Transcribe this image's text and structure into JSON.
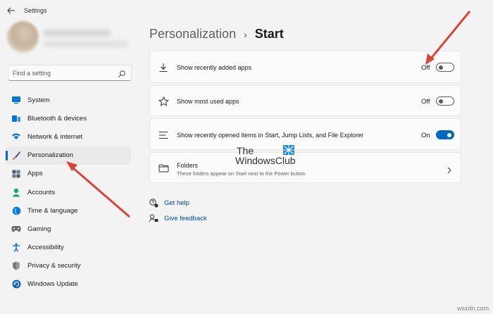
{
  "titlebar": {
    "title": "Settings",
    "back_icon": "back-arrow-icon"
  },
  "search": {
    "placeholder": "Find a setting",
    "icon": "search-icon"
  },
  "sidebar": {
    "items": [
      {
        "label": "System",
        "icon": "system-icon",
        "color": "#0078d4"
      },
      {
        "label": "Bluetooth & devices",
        "icon": "bluetooth-icon",
        "color": "#0078d4"
      },
      {
        "label": "Network & internet",
        "icon": "wifi-icon",
        "color": "#0b78c8"
      },
      {
        "label": "Personalization",
        "icon": "brush-icon",
        "color": "#c86a3c",
        "active": true
      },
      {
        "label": "Apps",
        "icon": "apps-icon",
        "color": "#4a5a6a"
      },
      {
        "label": "Accounts",
        "icon": "accounts-icon",
        "color": "#1aa36b"
      },
      {
        "label": "Time & language",
        "icon": "globe-icon",
        "color": "#0a7bd0"
      },
      {
        "label": "Gaming",
        "icon": "gaming-icon",
        "color": "#6d6d6d"
      },
      {
        "label": "Accessibility",
        "icon": "accessibility-icon",
        "color": "#1b6fc8"
      },
      {
        "label": "Privacy & security",
        "icon": "shield-icon",
        "color": "#7a7a7a"
      },
      {
        "label": "Windows Update",
        "icon": "update-icon",
        "color": "#0a64c0"
      }
    ]
  },
  "breadcrumb": {
    "parent": "Personalization",
    "separator": "›",
    "current": "Start"
  },
  "settings": [
    {
      "label": "Show recently added apps",
      "state": "Off",
      "on": false,
      "icon": "download-icon"
    },
    {
      "label": "Show most used apps",
      "state": "Off",
      "on": false,
      "icon": "star-icon"
    },
    {
      "label": "Show recently opened items in Start, Jump Lists, and File Explorer",
      "state": "On",
      "on": true,
      "icon": "list-icon"
    }
  ],
  "folders": {
    "label": "Folders",
    "description": "These folders appear on Start next to the Power button",
    "icon": "folder-icon"
  },
  "links": {
    "help": "Get help",
    "feedback": "Give feedback"
  },
  "watermark": {
    "line1": "The",
    "line2": "WindowsClub"
  },
  "site_mark": "wsxdn.com",
  "colors": {
    "accent": "#0067c0",
    "annotation_arrow": "#d9453a"
  }
}
